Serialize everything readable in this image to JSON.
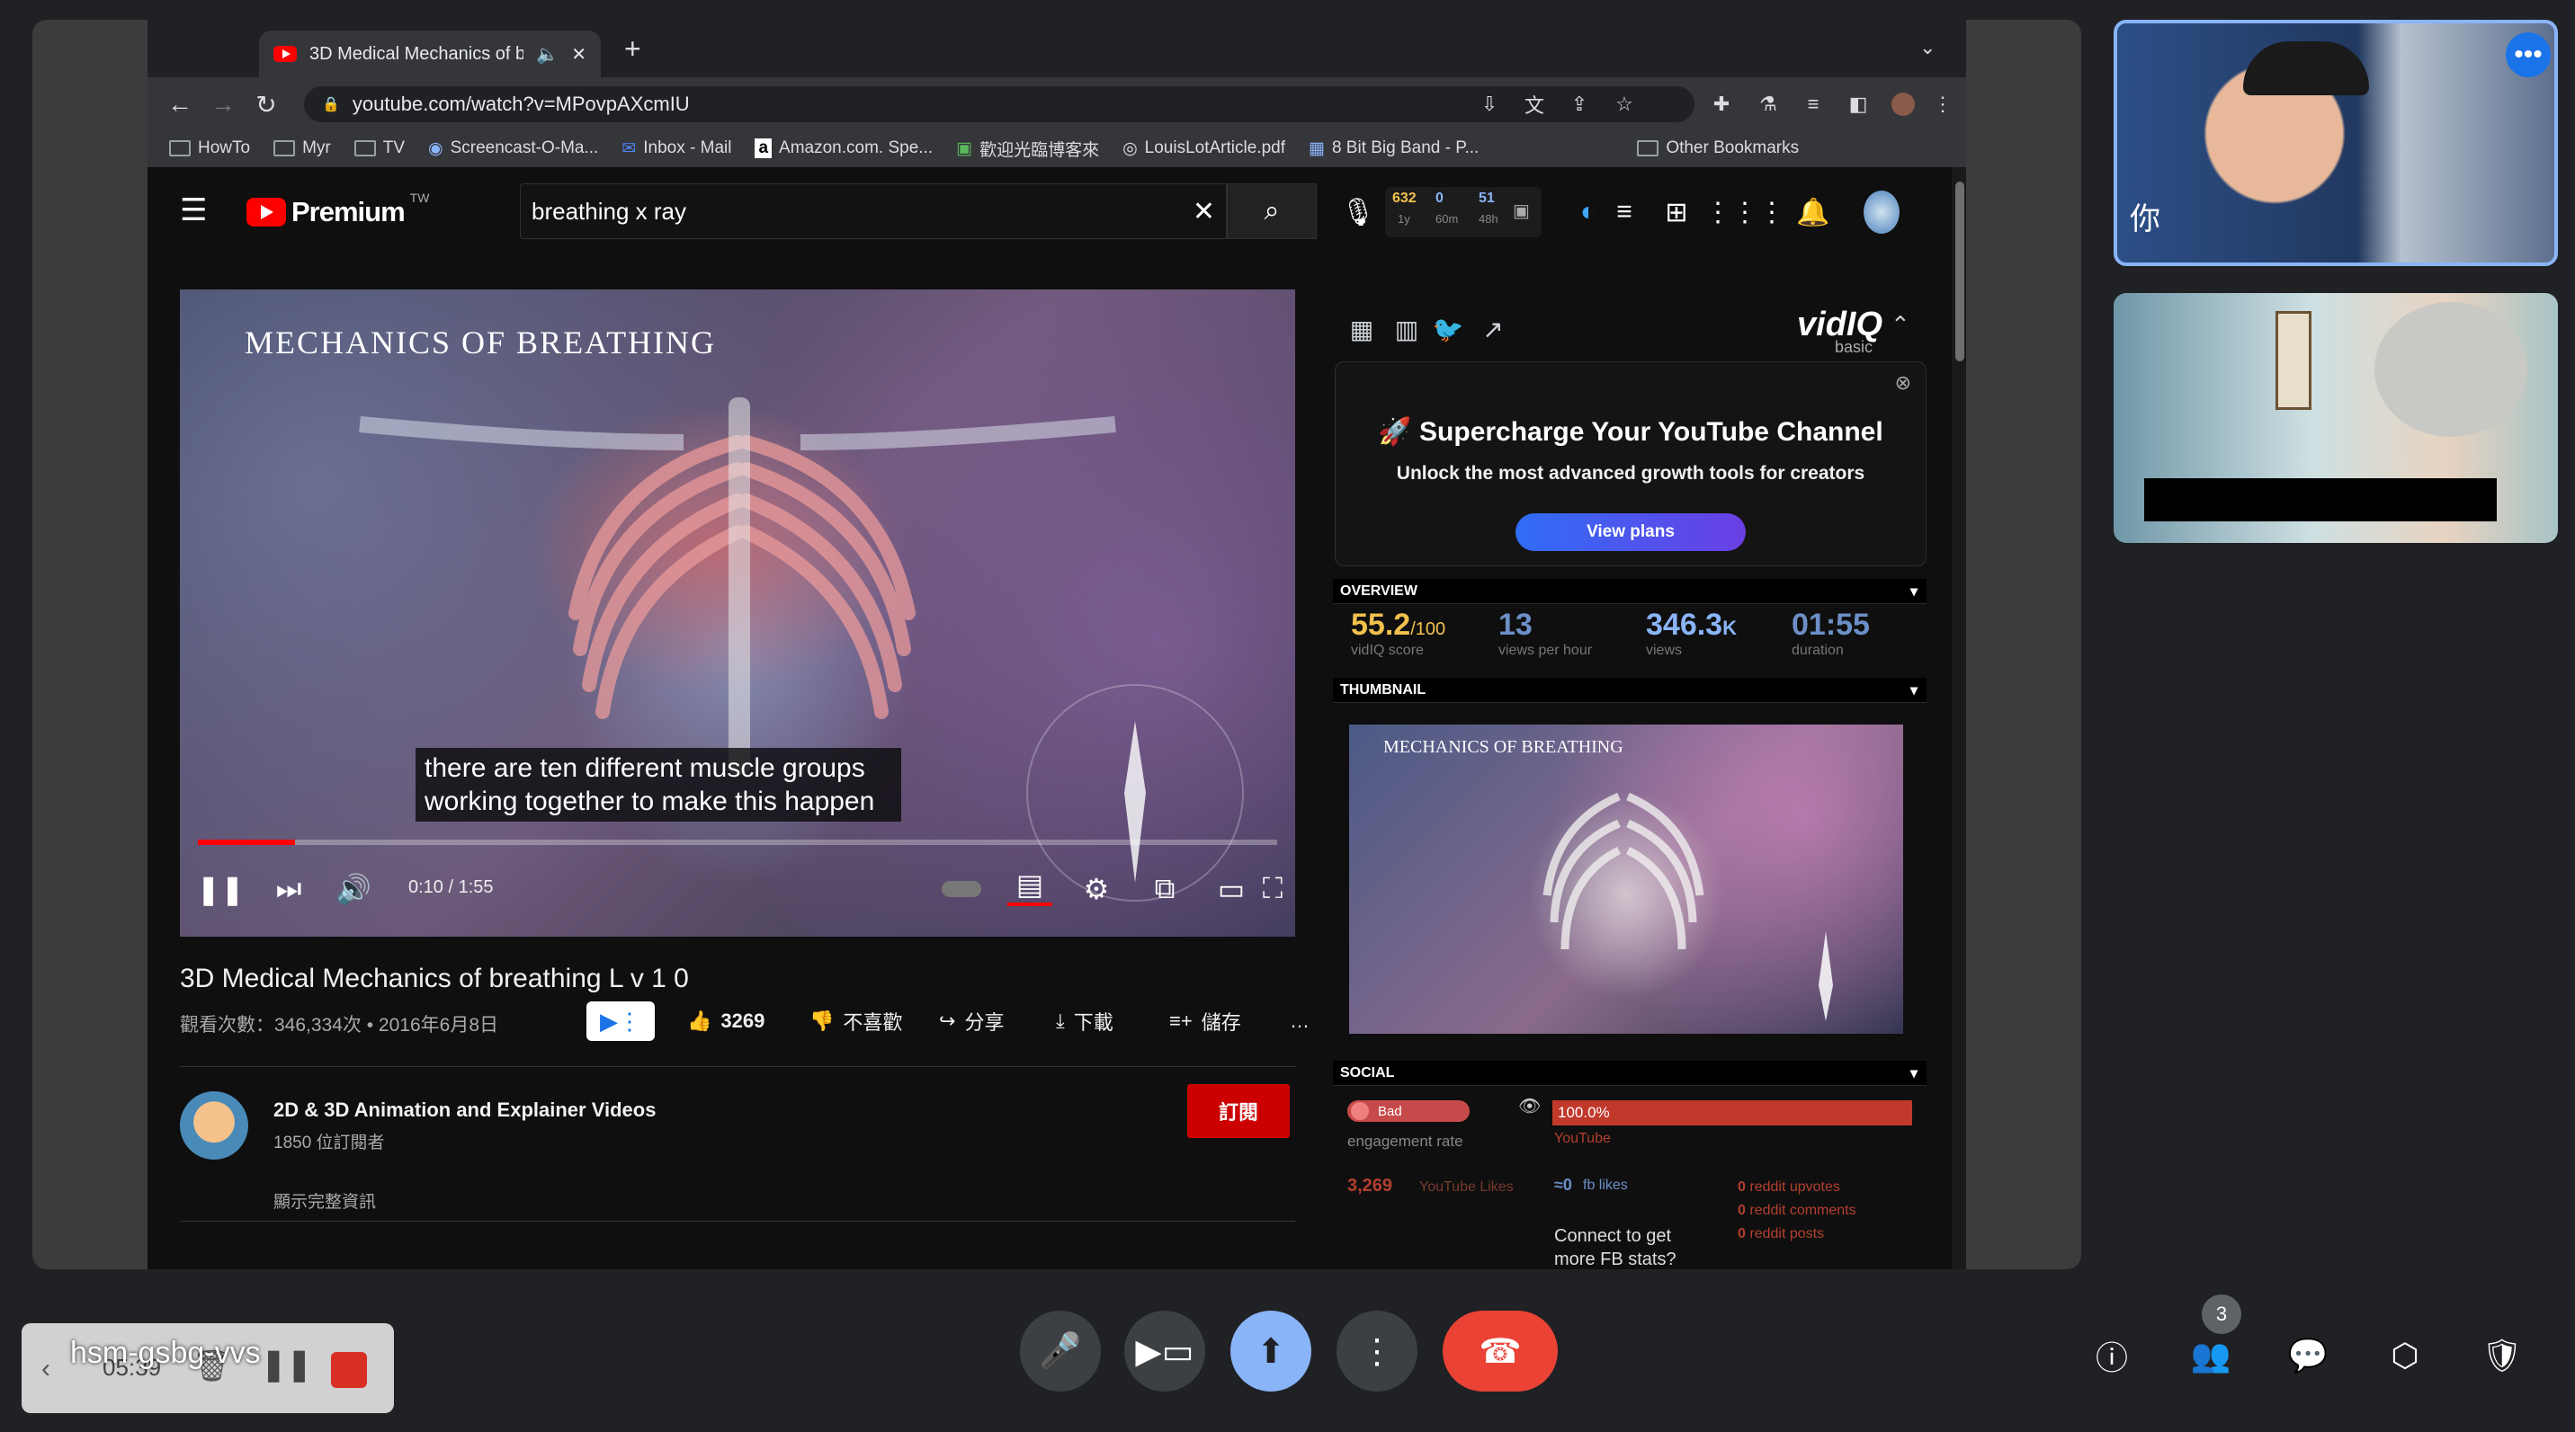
{
  "browser": {
    "tab_title": "3D Medical Mechanics of b",
    "url": "youtube.com/watch?v=MPovpAXcmIU",
    "bookmarks": [
      "HowTo",
      "Myr",
      "TV",
      "Screencast-O-Ma...",
      "Inbox - Mail",
      "Amazon.com. Spe...",
      "歡迎光臨博客來",
      "LouisLotArticle.pdf",
      "8 Bit Big Band - P..."
    ],
    "other_bookmarks": "Other Bookmarks"
  },
  "youtube": {
    "brand": "Premium",
    "brand_suffix": "TW",
    "search_value": "breathing x ray",
    "ext_counts": [
      "632",
      "0",
      "51"
    ],
    "ext_labels": [
      "1y",
      "60m",
      "48h"
    ]
  },
  "video": {
    "overlay_title": "MECHANICS OF BREATHING",
    "caption_line1": "there are ten different muscle groups",
    "caption_line2": "working together to make this happen",
    "time": "0:10 / 1:55",
    "progress": 0.09,
    "title": "3D Medical Mechanics of breathing L v 1 0",
    "meta": "觀看次數：346,334次 • 2016年6月8日",
    "likes": "3269",
    "dislike_label": "不喜歡",
    "share_label": "分享",
    "download_label": "下載",
    "save_label": "儲存",
    "more": "…"
  },
  "channel": {
    "name": "2D & 3D Animation and Explainer Videos",
    "subscribers": "1850 位訂閱者",
    "subscribe_label": "訂閱",
    "show_more": "顯示完整資訊"
  },
  "vidiq": {
    "logo": "vidIQ",
    "tier": "basic",
    "promo_title": "Supercharge Your YouTube Channel",
    "promo_subtitle": "Unlock the most advanced growth tools for creators",
    "promo_button": "View plans",
    "overview_label": "OVERVIEW",
    "score_value": "55.2",
    "score_max": "/100",
    "score_label": "vidIQ score",
    "vph_value": "13",
    "vph_label": "views per hour",
    "views_value": "346.3",
    "views_unit": "K",
    "views_label": "views",
    "duration_value": "01:55",
    "duration_label": "duration",
    "thumbnail_label": "THUMBNAIL",
    "thumb_text": "MECHANICS OF BREATHING",
    "social_label": "SOCIAL",
    "engagement_badge": "Bad",
    "engagement_label": "engagement rate",
    "engagement_pct": "100.0%",
    "engagement_source": "YouTube",
    "yt_likes_value": "3,269",
    "yt_likes_label": "YouTube Likes",
    "fb_likes_value": "0",
    "fb_likes_label": "fb likes",
    "reddit_upvotes_value": "0",
    "reddit_upvotes_label": "reddit upvotes",
    "reddit_comments_value": "0",
    "reddit_comments_label": "reddit comments",
    "reddit_posts_value": "0",
    "reddit_posts_label": "reddit posts",
    "connect_line1": "Connect to get",
    "connect_line2": "more FB stats?"
  },
  "meet": {
    "recording_time": "05:39",
    "meeting_code": "hsm-gsbg-vvs",
    "participants_count": "3",
    "participant1_caption": "你"
  },
  "colors": {
    "accent_blue": "#8ab4f8",
    "end_call_red": "#ea4335",
    "youtube_red": "#ff0000",
    "vidiq_blue": "#2f6df6",
    "score_gold": "#f2c14e"
  }
}
